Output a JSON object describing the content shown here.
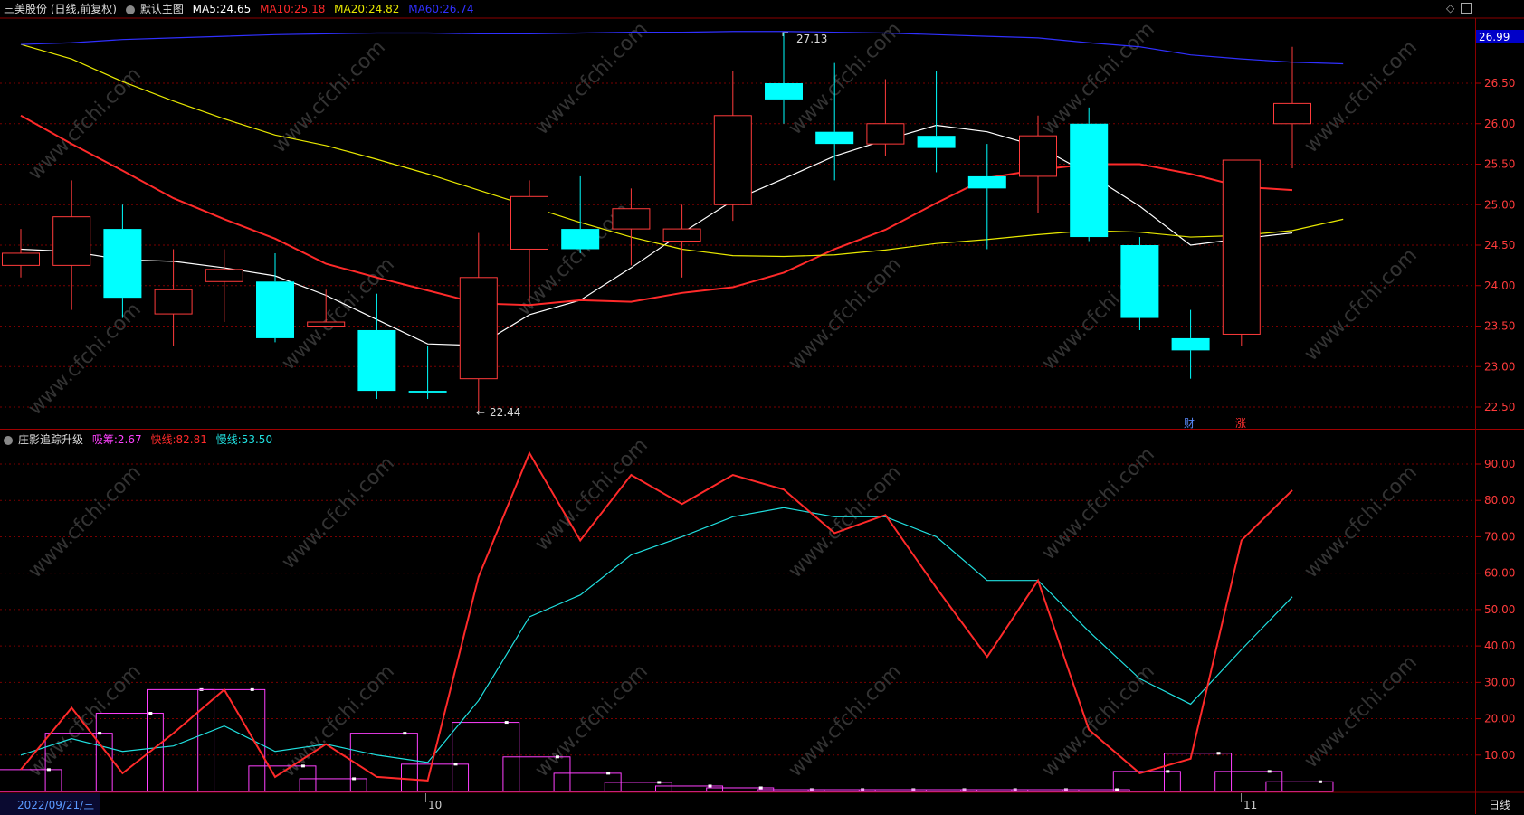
{
  "header": {
    "stock_title": "三美股份 (日线,前复权)",
    "main_chart_label": "默认主图",
    "ma5_label": "MA5:",
    "ma5_value": "24.65",
    "ma5_color": "#ffffff",
    "ma10_label": "MA10:",
    "ma10_value": "25.18",
    "ma10_color": "#ff2a2a",
    "ma20_label": "MA20:",
    "ma20_value": "24.82",
    "ma20_color": "#e8e800",
    "ma60_label": "MA60:",
    "ma60_value": "26.74",
    "ma60_color": "#3030ff"
  },
  "indicator_header": {
    "name": "庄影追踪升级",
    "xichou_label": "吸筹:",
    "xichou_value": "2.67",
    "xichou_color": "#ff40ff",
    "fast_label": "快线:",
    "fast_value": "82.81",
    "fast_color": "#ff2a2a",
    "slow_label": "慢线:",
    "slow_value": "53.50",
    "slow_color": "#20e0e0"
  },
  "footer": {
    "date_label": "2022/09/21/三",
    "month_oct": "10",
    "month_nov": "11",
    "period_label": "日线"
  },
  "price_axis": {
    "current_price": "26.99",
    "ticks": [
      "26.50",
      "26.00",
      "25.50",
      "25.00",
      "24.50",
      "24.00",
      "23.50",
      "23.00",
      "22.50"
    ]
  },
  "indicator_axis": {
    "ticks": [
      "90.00",
      "80.00",
      "70.00",
      "60.00",
      "50.00",
      "40.00",
      "30.00",
      "20.00",
      "10.00"
    ]
  },
  "markers": {
    "high_label": "27.13",
    "low_label": "22.44",
    "cai_label": "财",
    "zhang_label": "涨"
  },
  "watermark": "www.cfchi.com",
  "chart_data": [
    {
      "type": "candlestick",
      "title": "三美股份 (日线,前复权)",
      "ylim": [
        22.2,
        27.2
      ],
      "candles": [
        {
          "o": 24.25,
          "h": 24.7,
          "l": 24.1,
          "c": 24.4
        },
        {
          "o": 24.25,
          "h": 25.3,
          "l": 23.7,
          "c": 24.85
        },
        {
          "o": 24.7,
          "h": 25.0,
          "l": 23.6,
          "c": 23.85
        },
        {
          "o": 23.65,
          "h": 24.45,
          "l": 23.25,
          "c": 23.95
        },
        {
          "o": 24.05,
          "h": 24.45,
          "l": 23.55,
          "c": 24.2
        },
        {
          "o": 24.05,
          "h": 24.4,
          "l": 23.3,
          "c": 23.35
        },
        {
          "o": 23.5,
          "h": 23.95,
          "l": 23.5,
          "c": 23.55
        },
        {
          "o": 23.45,
          "h": 23.9,
          "l": 22.6,
          "c": 22.7
        },
        {
          "o": 22.7,
          "h": 23.25,
          "l": 22.6,
          "c": 22.68
        },
        {
          "o": 22.85,
          "h": 24.65,
          "l": 22.44,
          "c": 24.1
        },
        {
          "o": 24.45,
          "h": 25.3,
          "l": 23.8,
          "c": 25.1
        },
        {
          "o": 24.7,
          "h": 25.35,
          "l": 24.4,
          "c": 24.45
        },
        {
          "o": 24.7,
          "h": 25.2,
          "l": 24.25,
          "c": 24.95
        },
        {
          "o": 24.55,
          "h": 25.0,
          "l": 24.1,
          "c": 24.7
        },
        {
          "o": 25.0,
          "h": 26.65,
          "l": 24.8,
          "c": 26.1
        },
        {
          "o": 26.5,
          "h": 27.13,
          "l": 26.0,
          "c": 26.3
        },
        {
          "o": 25.9,
          "h": 26.75,
          "l": 25.3,
          "c": 25.75
        },
        {
          "o": 25.75,
          "h": 26.55,
          "l": 25.6,
          "c": 26.0
        },
        {
          "o": 25.85,
          "h": 26.65,
          "l": 25.4,
          "c": 25.7
        },
        {
          "o": 25.35,
          "h": 25.75,
          "l": 24.45,
          "c": 25.2
        },
        {
          "o": 25.35,
          "h": 26.1,
          "l": 24.9,
          "c": 25.85
        },
        {
          "o": 26.0,
          "h": 26.2,
          "l": 24.55,
          "c": 24.6
        },
        {
          "o": 24.5,
          "h": 24.6,
          "l": 23.45,
          "c": 23.6
        },
        {
          "o": 23.35,
          "h": 23.7,
          "l": 22.85,
          "c": 23.2
        },
        {
          "o": 23.4,
          "h": 25.55,
          "l": 23.25,
          "c": 25.55
        },
        {
          "o": 26.0,
          "h": 26.95,
          "l": 25.45,
          "c": 26.25
        }
      ],
      "series": [
        {
          "name": "MA5",
          "color": "#ffffff",
          "values": [
            24.45,
            24.42,
            24.32,
            24.3,
            24.22,
            24.12,
            23.88,
            23.58,
            23.28,
            23.26,
            23.64,
            23.82,
            24.22,
            24.65,
            25.05,
            25.32,
            25.6,
            25.8,
            25.98,
            25.9,
            25.72,
            25.38,
            24.98,
            24.5,
            24.58,
            24.65
          ]
        },
        {
          "name": "MA10",
          "color": "#ff2a2a",
          "values": [
            26.1,
            25.75,
            25.42,
            25.08,
            24.82,
            24.58,
            24.27,
            24.1,
            23.94,
            23.78,
            23.76,
            23.82,
            23.8,
            23.91,
            23.98,
            24.16,
            24.45,
            24.69,
            25.02,
            25.33,
            25.43,
            25.5,
            25.5,
            25.38,
            25.22,
            25.18
          ]
        },
        {
          "name": "MA20",
          "color": "#e8e800",
          "values": [
            26.98,
            26.8,
            26.52,
            26.28,
            26.06,
            25.86,
            25.73,
            25.56,
            25.38,
            25.18,
            24.98,
            24.78,
            24.6,
            24.45,
            24.37,
            24.36,
            24.38,
            24.44,
            24.52,
            24.57,
            24.63,
            24.68,
            24.66,
            24.6,
            24.62,
            24.68,
            24.82
          ]
        },
        {
          "name": "MA60",
          "color": "#3030ff",
          "values": [
            26.98,
            27.0,
            27.04,
            27.06,
            27.08,
            27.1,
            27.11,
            27.12,
            27.12,
            27.11,
            27.11,
            27.12,
            27.13,
            27.13,
            27.14,
            27.14,
            27.13,
            27.12,
            27.1,
            27.08,
            27.06,
            27.0,
            26.95,
            26.85,
            26.8,
            26.76,
            26.74
          ]
        }
      ]
    },
    {
      "type": "line",
      "title": "庄影追踪升级",
      "ylim": [
        0,
        100
      ],
      "categories_count": 26,
      "series": [
        {
          "name": "快线",
          "color": "#ff2a2a",
          "values": [
            6,
            23,
            5,
            16,
            28,
            4,
            13,
            4,
            3,
            59,
            93,
            69,
            87,
            79,
            87,
            83,
            71,
            76,
            56,
            37,
            58,
            17,
            5,
            9,
            69,
            82.81
          ]
        },
        {
          "name": "慢线",
          "color": "#20e0e0",
          "values": [
            10,
            14.5,
            11,
            12.5,
            18,
            11,
            13,
            10,
            8,
            25,
            48,
            54,
            65,
            70,
            75.5,
            78,
            75.5,
            75.5,
            70,
            58,
            58,
            44,
            31,
            24,
            39,
            53.5
          ]
        },
        {
          "name": "吸筹",
          "color": "#ff40ff",
          "type": "step-bar",
          "values": [
            6,
            16,
            21.5,
            28,
            28,
            7,
            3.5,
            16,
            7.5,
            19,
            9.5,
            5,
            2.5,
            1.5,
            1,
            0.5,
            0.5,
            0.5,
            0.5,
            0.5,
            0.5,
            0.5,
            5.5,
            10.5,
            5.5,
            2.67
          ]
        }
      ]
    }
  ]
}
